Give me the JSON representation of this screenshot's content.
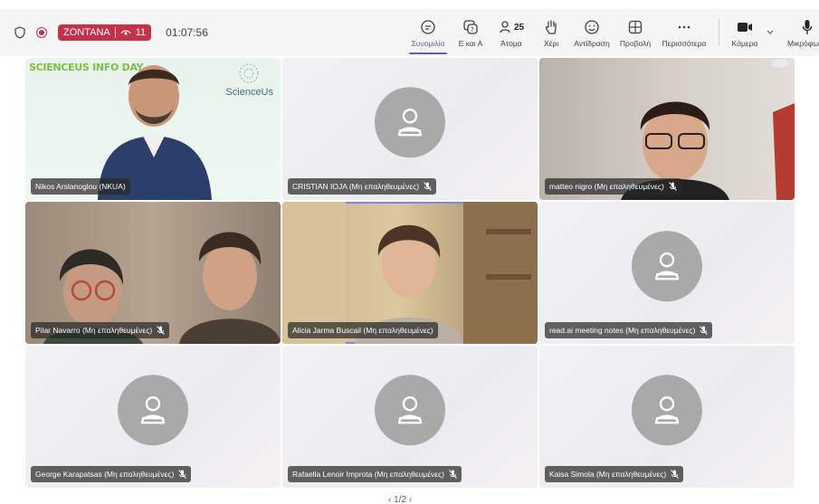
{
  "meeting": {
    "live_label": "ZONTANA",
    "viewers": "11",
    "timer": "01:07:56"
  },
  "toolbar": {
    "chat": "Συνομιλία",
    "qa": "Ε και Α",
    "people": "Άτομα",
    "people_count": "25",
    "hand": "Χέρι",
    "react": "Αντίδραση",
    "view": "Προβολή",
    "more": "Περισσότερα",
    "camera": "Κάμερα",
    "mic": "Μικρόφωνο"
  },
  "colors": {
    "accent": "#5b5fc7",
    "live": "#c4314b",
    "avatar": "#a9a9a9"
  },
  "tiles": [
    {
      "name": "Nikos Arslanoglou (NKUA)",
      "video": true,
      "muted": false,
      "brand": "SCIENCEUS INFO DAY",
      "brand2": "ScienceUs"
    },
    {
      "name": "CRISTIAN IOJA (Μη επαληθευμένες)",
      "video": false,
      "muted": true
    },
    {
      "name": "matteo nigro (Μη επαληθευμένες)",
      "video": true,
      "muted": true
    },
    {
      "name": "Pilar Navarro (Μη επαληθευμένες)",
      "video": true,
      "muted": true
    },
    {
      "name": "Alicia Jarma Buscail (Μη επαληθευμένες)",
      "video": true,
      "muted": false
    },
    {
      "name": "read.ai meeting notes (Μη επαληθευμένες)",
      "video": false,
      "muted": true
    },
    {
      "name": "George Karapatsas (Μη επαληθευμένες)",
      "video": false,
      "muted": true
    },
    {
      "name": "Rafaella Lenoir Improta (Μη επαληθευμένες)",
      "video": false,
      "muted": true
    },
    {
      "name": "Kaisa Simola (Μη επαληθευμένες)",
      "video": false,
      "muted": true
    }
  ],
  "pager": "1/2"
}
